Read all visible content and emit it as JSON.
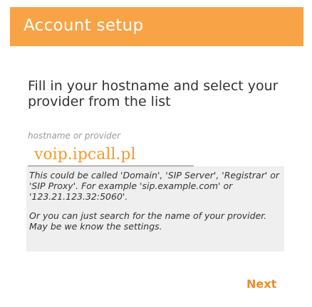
{
  "header": {
    "title": "Account setup"
  },
  "instruction": "Fill in your hostname and select your provider from the list",
  "hostname_field": {
    "label": "hostname or provider",
    "value": "voip.ipcall.pl"
  },
  "info": {
    "paragraph1": "This could be called 'Domain', 'SIP Server', 'Registrar' or 'SIP Proxy'. For example 'sip.example.com' or '123.21.123.32:5060'.",
    "paragraph2": "Or you can just search for the name of your provider. May be we know the settings."
  },
  "actions": {
    "next_label": "Next"
  },
  "colors": {
    "accent": "#f9a347",
    "next_text": "#f08a28",
    "input_text": "#f59a2e"
  }
}
